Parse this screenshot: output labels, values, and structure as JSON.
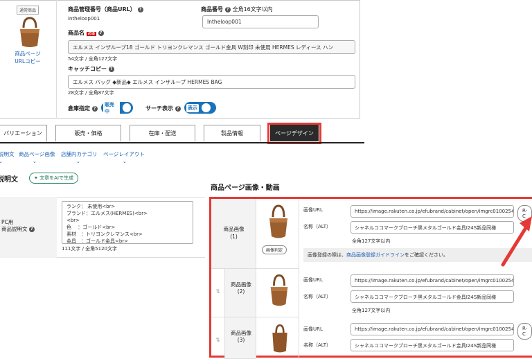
{
  "product": {
    "badge": "通常商品",
    "copy_link_1": "商品ページ",
    "copy_link_2": "URLコピー",
    "manage_no_label": "商品管理番号（商品URL）",
    "manage_no_value": "intheloop001",
    "item_no_label": "商品番号",
    "item_no_hint": "全角16文字以内",
    "item_no_value": "Intheloop001",
    "name_label": "商品名",
    "required": "必須",
    "name_value": "エルメス インザループ18 ゴールド トリヨンクレマンス ゴールド金具 W刻印 未使用 HERMES レディース ハン",
    "name_count": "54文字 / 全角127文字",
    "catch_label": "キャッチコピー",
    "catch_value": "エルメス バッグ ◆新品◆ エルメス インザループ HERMES BAG",
    "catch_count": "28文字 / 全角87文字",
    "warehouse_label": "倉庫指定",
    "warehouse_toggle": "販売中",
    "search_label": "サーチ表示",
    "search_toggle": "表示"
  },
  "tabs": [
    "バリエーション",
    "販売・価格",
    "在庫・配送",
    "製品情報",
    "ページデザイン"
  ],
  "subnav": [
    "説明文",
    "商品ページ画像",
    "店舗内カテゴリ",
    "ページレイアウト"
  ],
  "desc": {
    "title": "説明文",
    "ai_button": "文章をAIで生成",
    "pc_label_1": "PC用",
    "pc_label_2": "商品説明文",
    "lines": [
      "ランク： 未使用<br>",
      "ブランド：エルメス(HERMES)<br>",
      "<br>",
      "色　 ：ゴールド<br>",
      "素材　：トリヨンクレマンス<br>",
      "金具　：ゴールド金具<br>"
    ],
    "count": "111文字 / 全角5120文字"
  },
  "images": {
    "title": "商品ページ画像・動画",
    "url_label": "画像URL",
    "alt_label": "名称（ALT）",
    "rows": [
      {
        "label": "商品画像",
        "num": "(1)",
        "url": "https://image.rakuten.co.jp/efubrand/cabinet/open/imgrc0100254(",
        "alt": "シャネルココマークブローチ黒メタルゴールド金具I24S新品同様",
        "count": "全角127文字以内",
        "judge": "画像判定"
      },
      {
        "label": "商品画像",
        "num": "(2)",
        "url": "https://image.rakuten.co.jp/efubrand/cabinet/open/imgrc0100254(",
        "alt": "シャネルココマークブローチ黒メタルゴールド金具I24S新品同様",
        "count": "全角127文字以内"
      },
      {
        "label": "商品画像",
        "num": "(3)",
        "url": "https://image.rakuten.co.jp/efubrand/cabinet/open/imgrc0100254(",
        "alt": "シャネルココマークブローチ黒メタルゴールド金具I24S新品同様"
      }
    ],
    "rc_button": "R-C",
    "notice_pre": "画像登録の際は、",
    "notice_link": "商品画像登録ガイドライン",
    "notice_post": "をご確認ください。"
  }
}
